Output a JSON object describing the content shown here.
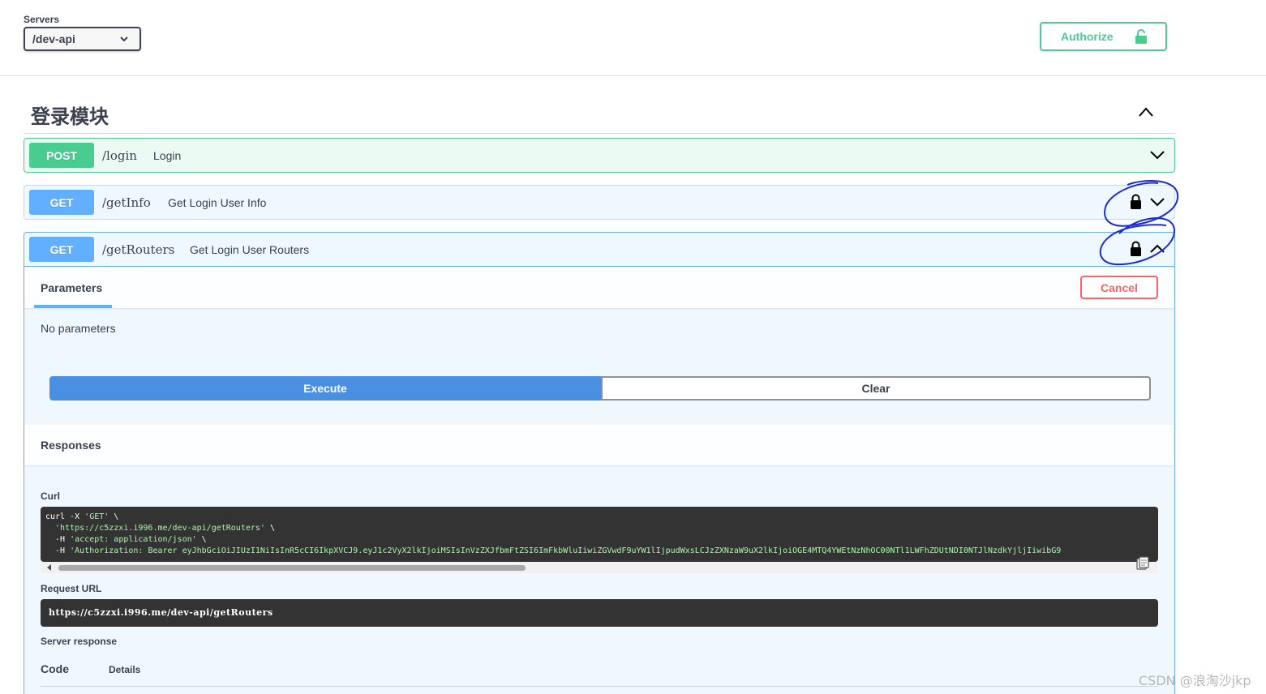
{
  "servers": {
    "label": "Servers",
    "selected": "/dev-api"
  },
  "authorize": {
    "label": "Authorize"
  },
  "tag": {
    "title": "登录模块"
  },
  "operations": [
    {
      "method": "POST",
      "path": "/login",
      "summary": "Login"
    },
    {
      "method": "GET",
      "path": "/getInfo",
      "summary": "Get Login User Info"
    },
    {
      "method": "GET",
      "path": "/getRouters",
      "summary": "Get Login User Routers"
    }
  ],
  "expanded": {
    "params_tab": "Parameters",
    "cancel_label": "Cancel",
    "no_params": "No parameters",
    "execute_label": "Execute",
    "clear_label": "Clear",
    "responses_title": "Responses",
    "curl_label": "Curl",
    "curl_lines": [
      "curl -X ",
      "'GET'",
      " \\",
      "  'https://c5zzxi.i996.me/dev-api/getRouters'",
      " \\",
      "  -H ",
      "'accept: application/json'",
      " \\",
      "  -H ",
      "'Authorization: Bearer eyJhbGciOiJIUzI1NiIsInR5cCI6IkpXVCJ9.eyJ1c2VyX2lkIjoiMSIsInVzZXJfbmFtZSI6ImFkbWluIiwiZGVwdF9uYW1lIjpudWxsLCJzZXNzaW9uX2lkIjoiOGE4MTQ4YWEtNzNhOC00NTl1LWFhZDUtNDI0NTJlNzdkYjljIiwibG9"
    ],
    "request_url_label": "Request URL",
    "request_url": "https://c5zzxi.i996.me/dev-api/getRouters",
    "server_response_label": "Server response",
    "code_col": "Code",
    "details_col": "Details"
  },
  "watermark": "CSDN @浪淘沙jkp",
  "colors": {
    "post": "#49cc90",
    "get": "#61affe",
    "execute": "#4990e2",
    "cancel": "#ff6060",
    "annotation": "#1a2bd6"
  }
}
